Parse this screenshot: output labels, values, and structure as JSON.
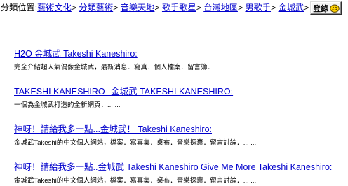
{
  "breadcrumb": {
    "label": "分類位置:",
    "items": [
      {
        "label": "藝術文化",
        "sep": ">"
      },
      {
        "label": "分類藝術",
        "sep": ">"
      },
      {
        "label": "音樂天地",
        "sep": ">"
      },
      {
        "label": "歌手歌星",
        "sep": ">"
      },
      {
        "label": "台灣地區",
        "sep": ">"
      },
      {
        "label": "男歌手",
        "sep": ">"
      },
      {
        "label": "金城武",
        "sep": ">"
      }
    ]
  },
  "login_button": {
    "label": "登錄",
    "icon": "smiley-icon"
  },
  "listings": [
    {
      "title": "H2O 金城武 Takeshi Kaneshiro:",
      "description": "完全介紹超人氣偶像金城武，最新消息．寫真．個人檔案．留言簿．... ..."
    },
    {
      "title": "TAKESHI KANESHIRO--金城武 TAKESHI KANESHIRO:",
      "description": "一個為金城武打造的全新網頁．... ..."
    },
    {
      "title": "神呀！請給我多一點...金城武！ Takeshi Kaneshiro:",
      "description": "金城武Takeshi的中文個人網站，檔案．寫真集．桌布．音樂探囊．留言討論．... ..."
    },
    {
      "title": "神呀！請給我多一點..金城武 Takeshi Kaneshiro Give Me More Takeshi Kaneshiro:",
      "description": "金城武Takeshi的中文個人網站，檔案．寫真集．桌布．音樂探囊．留言討論．... ..."
    }
  ],
  "colors": {
    "link": "#0000cc",
    "icon_fill": "#ffd200",
    "icon_outline": "#5a4300"
  }
}
